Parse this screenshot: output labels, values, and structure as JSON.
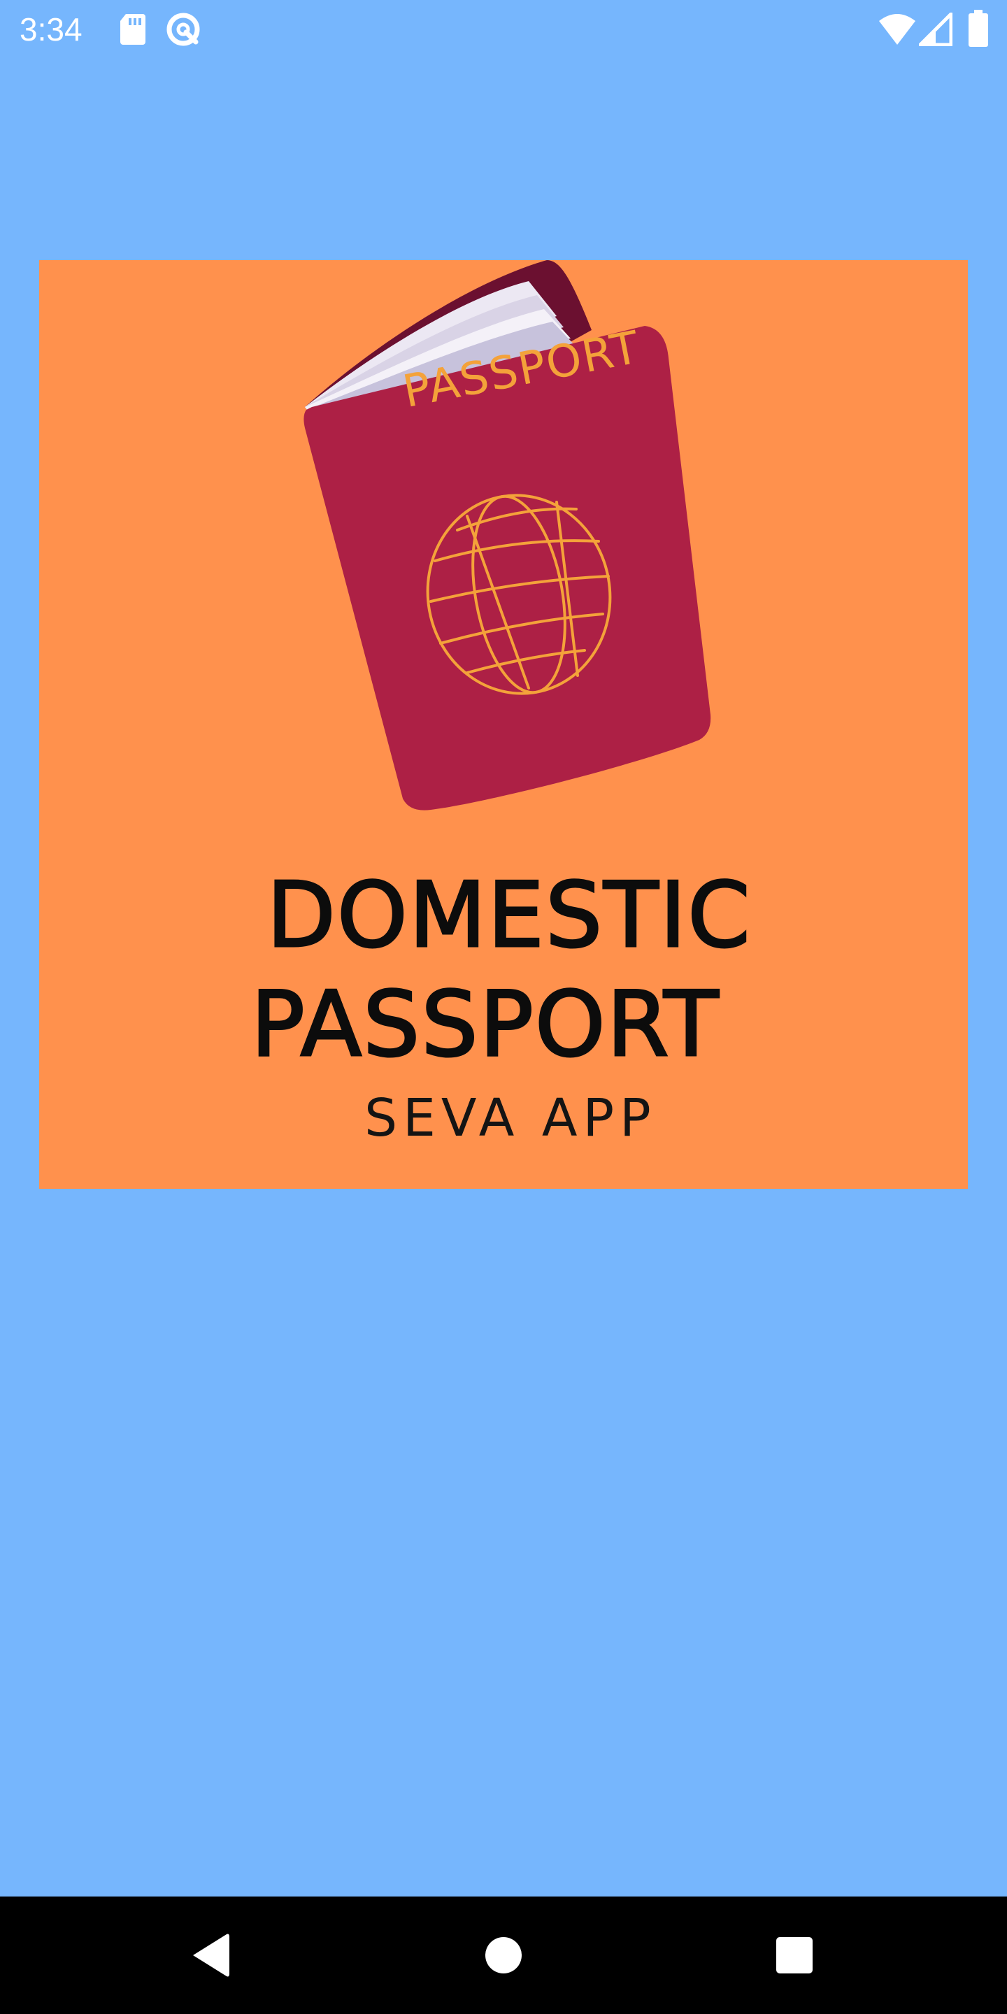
{
  "status_bar": {
    "time": "3:34",
    "left_icons": [
      "sd-card-icon",
      "sync-icon"
    ],
    "right_icons": [
      "wifi-icon",
      "cellular-signal-icon",
      "battery-icon"
    ]
  },
  "splash": {
    "cover_text": "PASSPORT",
    "title_line_1": "DOMESTIC",
    "title_line_2": "PASSPORT",
    "subtitle": "SEVA APP"
  },
  "colors": {
    "background": "#76b6fd",
    "card": "#ff914d",
    "passport_cover": "#ad2045",
    "passport_spine": "#6b1030",
    "cover_line_art": "#f4a23a",
    "title_text": "#0c0c0c",
    "nav_bar": "#000000"
  },
  "navigation": {
    "buttons": [
      "back-icon",
      "home-icon",
      "recents-icon"
    ]
  }
}
